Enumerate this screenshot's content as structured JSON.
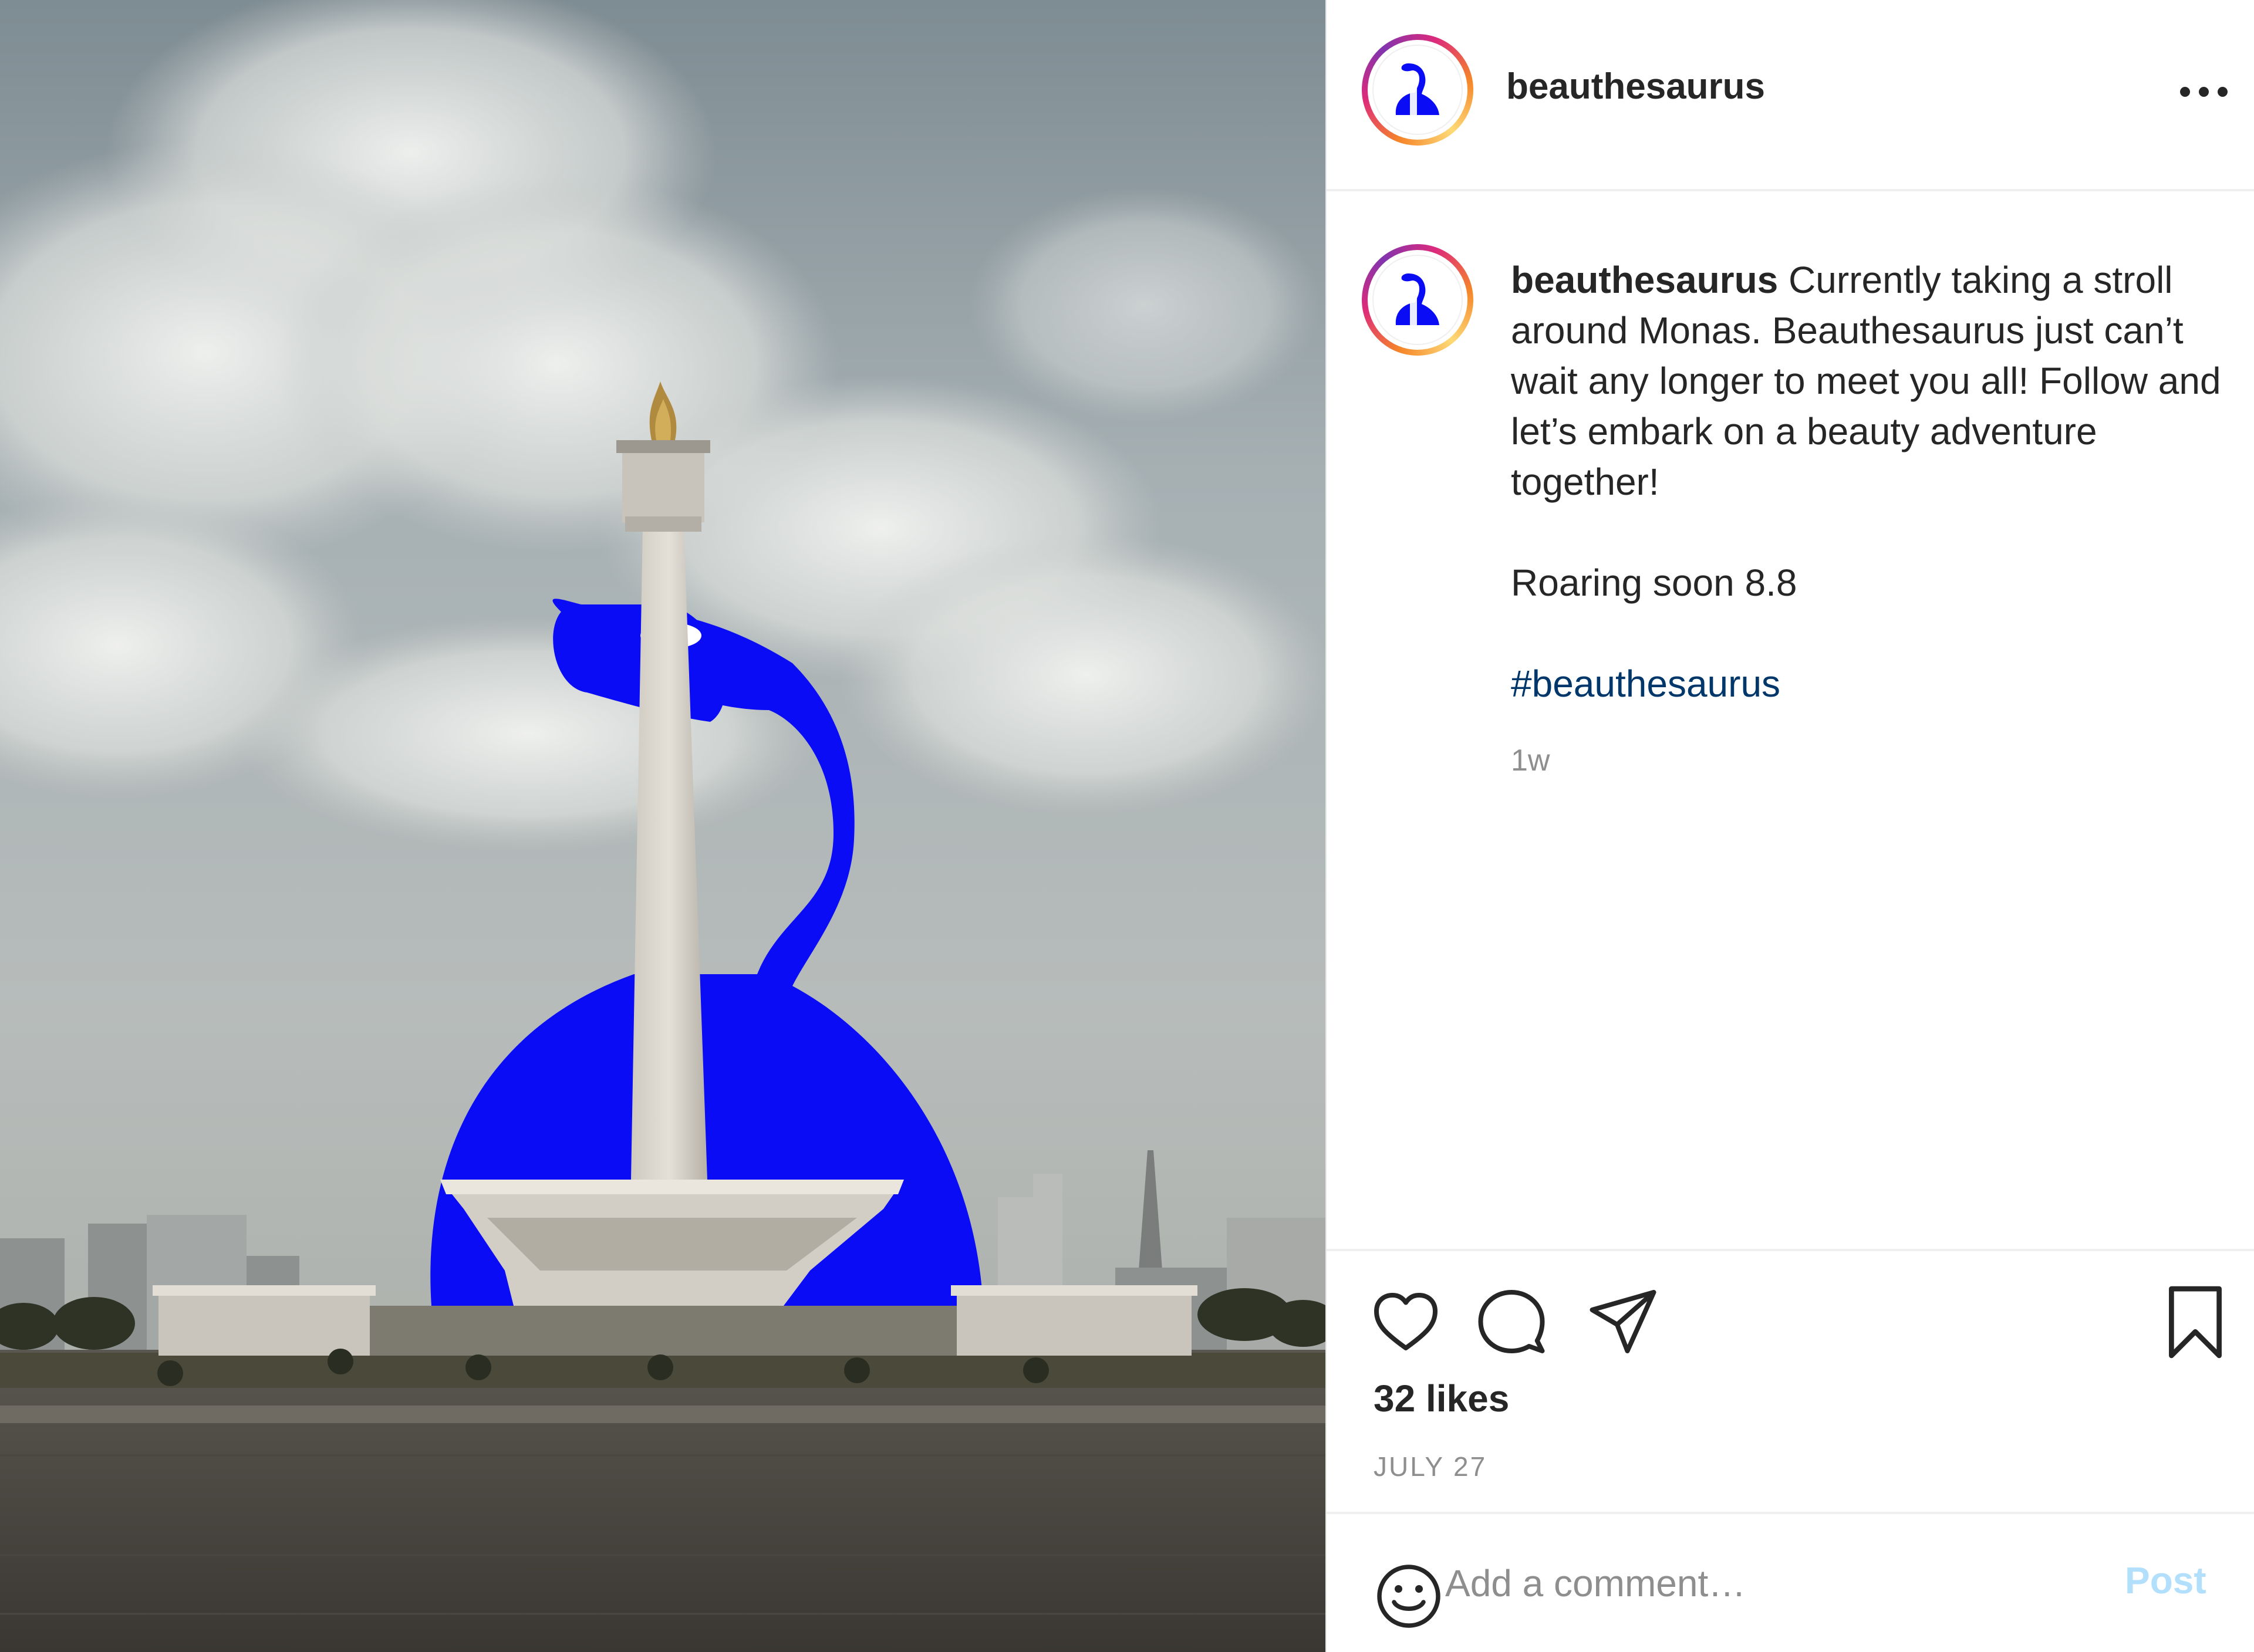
{
  "post": {
    "username": "beauthesaurus",
    "more_icon": "more-horizontal-icon",
    "image_subject": "Blue dinosaur illustration wrapped around Monas monument"
  },
  "caption": {
    "username": "beauthesaurus",
    "line1": "Currently taking a stroll around Monas. Beauthesaurus just can’t wait any longer to meet you all! Follow and let’s embark on a beauty adventure together!",
    "line2": "Roaring soon 8.8",
    "hashtag": "#beauthesaurus",
    "time": "1w"
  },
  "actions": {
    "like_icon": "heart-icon",
    "comment_icon": "comment-icon",
    "share_icon": "send-icon",
    "save_icon": "bookmark-icon",
    "likes": "32 likes",
    "date": "JULY 27"
  },
  "comment": {
    "emoji_icon": "smiley-icon",
    "placeholder": "Add a comment…",
    "post_label": "Post"
  },
  "colors": {
    "dino_blue": "#0a0cf5",
    "hashtag": "#00376b",
    "post_disabled": "#b2dffc",
    "muted": "#8e8e8e"
  }
}
